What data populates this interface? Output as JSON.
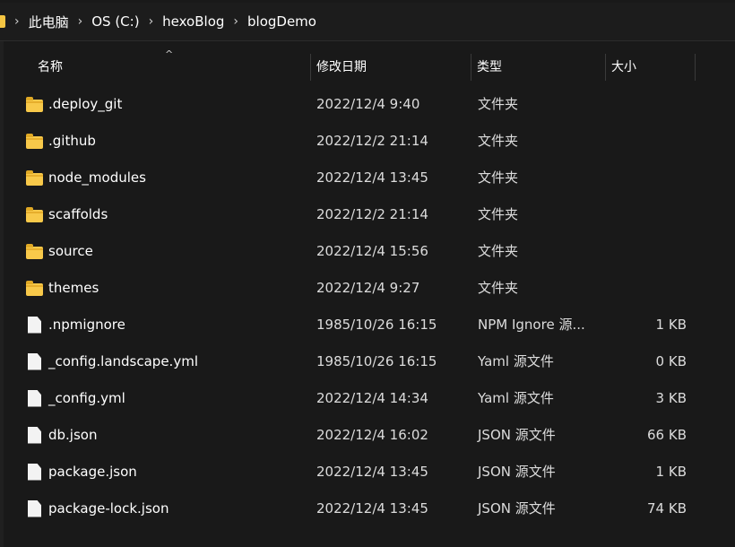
{
  "breadcrumb": {
    "items": [
      "此电脑",
      "OS (C:)",
      "hexoBlog",
      "blogDemo"
    ]
  },
  "columns": {
    "name": "名称",
    "date": "修改日期",
    "type": "类型",
    "size": "大小",
    "sort_indicator": "^"
  },
  "rows": [
    {
      "kind": "folder",
      "name": ".deploy_git",
      "date": "2022/12/4 9:40",
      "type": "文件夹",
      "size": ""
    },
    {
      "kind": "folder",
      "name": ".github",
      "date": "2022/12/2 21:14",
      "type": "文件夹",
      "size": ""
    },
    {
      "kind": "folder",
      "name": "node_modules",
      "date": "2022/12/4 13:45",
      "type": "文件夹",
      "size": ""
    },
    {
      "kind": "folder",
      "name": "scaffolds",
      "date": "2022/12/2 21:14",
      "type": "文件夹",
      "size": ""
    },
    {
      "kind": "folder",
      "name": "source",
      "date": "2022/12/4 15:56",
      "type": "文件夹",
      "size": ""
    },
    {
      "kind": "folder",
      "name": "themes",
      "date": "2022/12/4 9:27",
      "type": "文件夹",
      "size": ""
    },
    {
      "kind": "file",
      "name": ".npmignore",
      "date": "1985/10/26 16:15",
      "type": "NPM Ignore 源...",
      "size": "1 KB"
    },
    {
      "kind": "file",
      "name": "_config.landscape.yml",
      "date": "1985/10/26 16:15",
      "type": "Yaml 源文件",
      "size": "0 KB"
    },
    {
      "kind": "file",
      "name": "_config.yml",
      "date": "2022/12/4 14:34",
      "type": "Yaml 源文件",
      "size": "3 KB"
    },
    {
      "kind": "file",
      "name": "db.json",
      "date": "2022/12/4 16:02",
      "type": "JSON 源文件",
      "size": "66 KB"
    },
    {
      "kind": "file",
      "name": "package.json",
      "date": "2022/12/4 13:45",
      "type": "JSON 源文件",
      "size": "1 KB"
    },
    {
      "kind": "file",
      "name": "package-lock.json",
      "date": "2022/12/4 13:45",
      "type": "JSON 源文件",
      "size": "74 KB"
    }
  ],
  "icons": {
    "folder": "folder-icon",
    "file": "file-icon",
    "separator": "chevron-right-icon"
  },
  "colors": {
    "background": "#191919",
    "folder": "#f8c94a",
    "file": "#f3f3f3",
    "text": "#ffffff"
  }
}
